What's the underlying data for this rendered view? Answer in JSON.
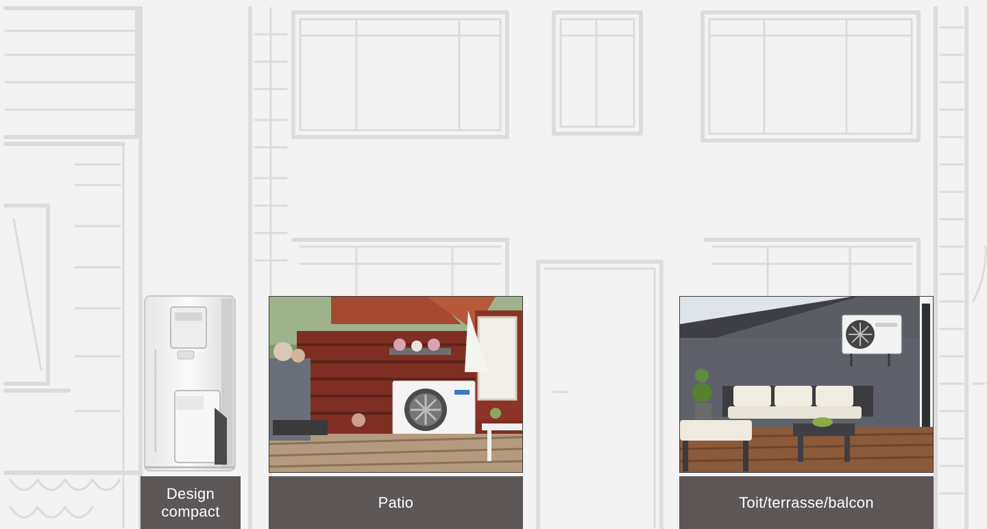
{
  "cards": {
    "compact": {
      "caption_line1": "Design",
      "caption_line2": "compact"
    },
    "patio": {
      "caption": "Patio"
    },
    "roof": {
      "caption": "Toit/terrasse/balcon"
    }
  },
  "colors": {
    "caption_bg": "#5c5657",
    "background": "#f3f3f3",
    "sketch_lines": "#dcdcdc"
  }
}
